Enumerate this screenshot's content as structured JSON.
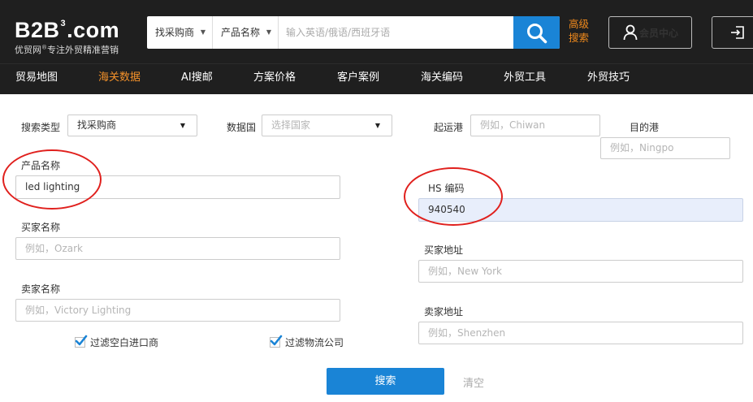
{
  "brand": {
    "logo_main_1": "B2B",
    "logo_sup": "3",
    "logo_main_2": ".com",
    "tagline_1": "优贸网",
    "tagline_reg": "®",
    "tagline_2": "专注外贸精准营销"
  },
  "header_search": {
    "type_select": "找采购商",
    "field_select": "产品名称",
    "placeholder": "输入英语/俄语/西班牙语",
    "search_icon": "magnifier-icon"
  },
  "advanced_search": {
    "line1": "高级",
    "line2": "搜索"
  },
  "member_center": {
    "label": "会员中心",
    "icon": "user-icon"
  },
  "login": {
    "icon": "login-icon"
  },
  "nav": {
    "items": [
      {
        "label": "贸易地图"
      },
      {
        "label": "海关数据"
      },
      {
        "label": "AI搜邮"
      },
      {
        "label": "方案价格"
      },
      {
        "label": "客户案例"
      },
      {
        "label": "海关编码"
      },
      {
        "label": "外贸工具"
      },
      {
        "label": "外贸技巧"
      }
    ],
    "active": "海关数据"
  },
  "form": {
    "search_type": {
      "label": "搜索类型",
      "value": "找采购商"
    },
    "data_country": {
      "label": "数据国",
      "placeholder": "选择国家"
    },
    "origin_port": {
      "label": "起运港",
      "placeholder": "例如，Chiwan"
    },
    "dest_port": {
      "label": "目的港",
      "placeholder": "例如，Ningpo"
    },
    "product_name": {
      "label": "产品名称",
      "value": "led lighting"
    },
    "hs_code": {
      "label": "HS 编码",
      "value": "940540"
    },
    "buyer_name": {
      "label": "买家名称",
      "placeholder": "例如，Ozark"
    },
    "buyer_address": {
      "label": "买家地址",
      "placeholder": "例如，New York"
    },
    "seller_name": {
      "label": "卖家名称",
      "placeholder": "例如，Victory Lighting"
    },
    "seller_address": {
      "label": "卖家地址",
      "placeholder": "例如，Shenzhen"
    },
    "filter_blank_importers": {
      "label": "过滤空白进口商",
      "checked": true
    },
    "filter_logistics": {
      "label": "过滤物流公司",
      "checked": true
    },
    "submit_label": "搜索",
    "clear_label": "清空"
  },
  "colors": {
    "header_bg": "#1f1f1f",
    "accent_orange": "#f5922a",
    "primary_blue": "#1a84d6",
    "annotation_red": "#e0201d"
  }
}
